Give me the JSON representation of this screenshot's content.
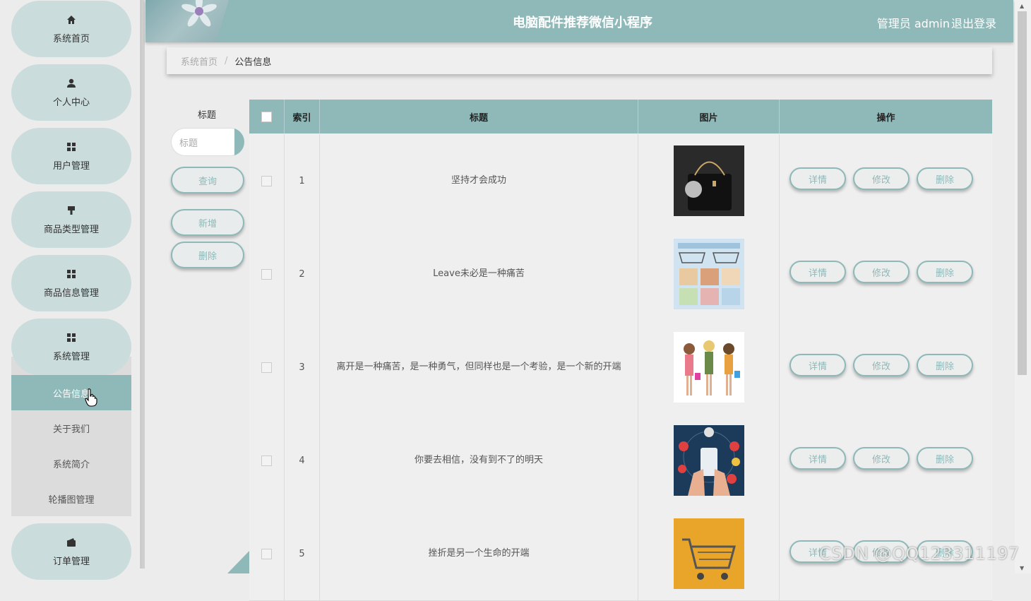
{
  "sidebar": {
    "items": [
      {
        "label": "系统首页",
        "icon": "home-icon"
      },
      {
        "label": "个人中心",
        "icon": "user-icon"
      },
      {
        "label": "用户管理",
        "icon": "grid-icon"
      },
      {
        "label": "商品类型管理",
        "icon": "brush-icon"
      },
      {
        "label": "商品信息管理",
        "icon": "grid-icon"
      },
      {
        "label": "系统管理",
        "icon": "grid-icon"
      },
      {
        "label": "订单管理",
        "icon": "wallet-icon"
      }
    ],
    "sub_items": [
      {
        "label": "公告信息",
        "active": true
      },
      {
        "label": "关于我们"
      },
      {
        "label": "系统简介"
      },
      {
        "label": "轮播图管理"
      }
    ]
  },
  "header": {
    "title": "电脑配件推荐微信小程序",
    "user": "管理员 admin",
    "logout": "退出登录"
  },
  "breadcrumb": {
    "home": "系统首页",
    "separator": "/",
    "current": "公告信息"
  },
  "search": {
    "label": "标题",
    "placeholder": "标题",
    "query_button": "查询",
    "add_button": "新增",
    "delete_button": "删除"
  },
  "table": {
    "headers": {
      "index": "索引",
      "title": "标题",
      "image": "图片",
      "actions": "操作"
    },
    "action_labels": {
      "detail": "详情",
      "edit": "修改",
      "delete": "删除"
    },
    "rows": [
      {
        "index": "1",
        "title": "坚持才会成功",
        "image": "handbag-photo"
      },
      {
        "index": "2",
        "title": "Leave未必是一种痛苦",
        "image": "shopping-cart-illustration"
      },
      {
        "index": "3",
        "title": "离开是一种痛苦，是一种勇气，但同样也是一个考验，是一个新的开端",
        "image": "shopping-girls-illustration"
      },
      {
        "index": "4",
        "title": "你要去相信，没有到不了的明天",
        "image": "mobile-shopping-illustration"
      },
      {
        "index": "5",
        "title": "挫折是另一个生命的开端",
        "image": "cart-orange-illustration"
      }
    ]
  },
  "watermark": "CSDN @QQ123311197",
  "colors": {
    "accent": "#8fb8b8",
    "sidebar_item": "#cbdcdc",
    "background": "#ececec"
  }
}
